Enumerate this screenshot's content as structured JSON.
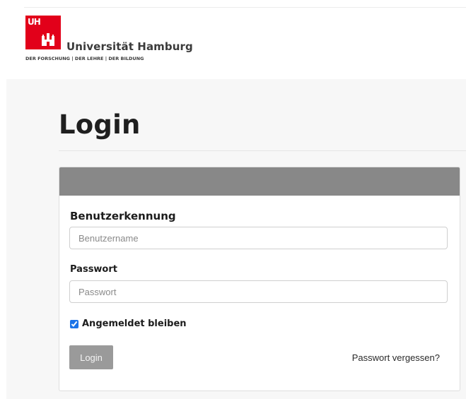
{
  "brand": {
    "mark": "UH",
    "name": "Universität Hamburg",
    "tagline": "DER FORSCHUNG | DER LEHRE | DER BILDUNG",
    "color": "#e2001a",
    "icon": "hamburg-castle-icon"
  },
  "page": {
    "title": "Login"
  },
  "form": {
    "username_label": "Benutzerkennung",
    "username_placeholder": "Benutzername",
    "password_label": "Passwort",
    "password_placeholder": "Passwort",
    "remember_label": "Angemeldet bleiben",
    "remember_checked": true,
    "submit_label": "Login",
    "forgot_label": "Passwort vergessen?"
  },
  "colors": {
    "card_header": "#888888",
    "button": "#9a9a9a",
    "checkbox": "#1a73e8"
  }
}
